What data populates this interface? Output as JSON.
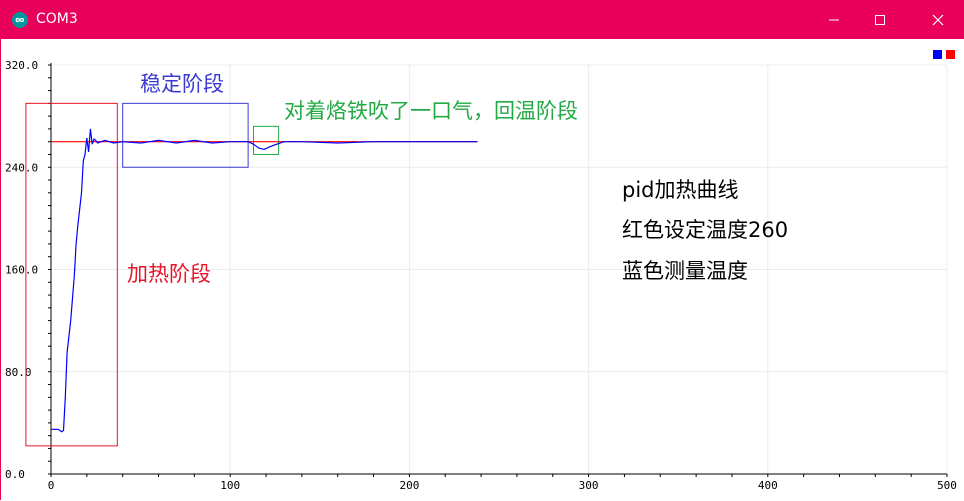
{
  "window": {
    "title": "COM3",
    "icon": "infinity-logo-icon",
    "controls": [
      "minimize-icon",
      "maximize-icon",
      "close-icon"
    ],
    "title_bar_color": "#e8005a"
  },
  "legend": {
    "swatches": [
      {
        "color": "#0000ff"
      },
      {
        "color": "#ff0000"
      }
    ]
  },
  "annotations": {
    "heating_phase": "加热阶段",
    "stable_phase": "稳定阶段",
    "recovery_phase": "对着烙铁吹了一口气，回温阶段",
    "note_line1": "pid加热曲线",
    "note_line2": "红色设定温度260",
    "note_line3": "蓝色测量温度",
    "colors": {
      "heating": "#e8142a",
      "stable": "#3a3ad0",
      "recovery": "#22aa44",
      "note": "#000000"
    }
  },
  "chart_data": {
    "type": "line",
    "x_ticks": [
      "0",
      "100",
      "200",
      "300",
      "400",
      "500"
    ],
    "y_ticks": [
      "0.0",
      "80.0",
      "160.0",
      "240.0",
      "320.0"
    ],
    "xlim": [
      0,
      500
    ],
    "ylim": [
      0,
      320
    ],
    "grid": true,
    "series": [
      {
        "color": "#ff0000",
        "x": [
          0,
          238
        ],
        "y": [
          260,
          260
        ]
      },
      {
        "color": "#0000ff",
        "x": [
          0,
          4,
          6,
          7,
          8,
          9,
          11,
          13,
          14,
          15,
          17,
          18,
          19,
          20,
          21,
          22,
          23,
          24,
          25,
          26,
          28,
          30,
          35,
          40,
          50,
          60,
          70,
          80,
          90,
          100,
          110,
          113,
          116,
          119,
          122,
          126,
          130,
          140,
          160,
          180,
          200,
          220,
          238
        ],
        "y": [
          35,
          35,
          33,
          34,
          60,
          95,
          120,
          155,
          180,
          195,
          220,
          245,
          250,
          263,
          252,
          270,
          258,
          262,
          261,
          259,
          260,
          261,
          259,
          260,
          259,
          261,
          259,
          261,
          259,
          260,
          260,
          258,
          255,
          254,
          256,
          258,
          260,
          260,
          259,
          260,
          260,
          260,
          260
        ]
      }
    ],
    "regions": [
      {
        "label_key": "heating",
        "x": [
          -14,
          37
        ],
        "y": [
          22,
          290
        ],
        "color": "#e8142a"
      },
      {
        "label_key": "stable",
        "x": [
          40,
          110
        ],
        "y": [
          240,
          290
        ],
        "color": "#3a3ad0"
      },
      {
        "label_key": "recovery",
        "x": [
          113,
          127
        ],
        "y": [
          250,
          272
        ],
        "color": "#22aa44"
      }
    ]
  }
}
